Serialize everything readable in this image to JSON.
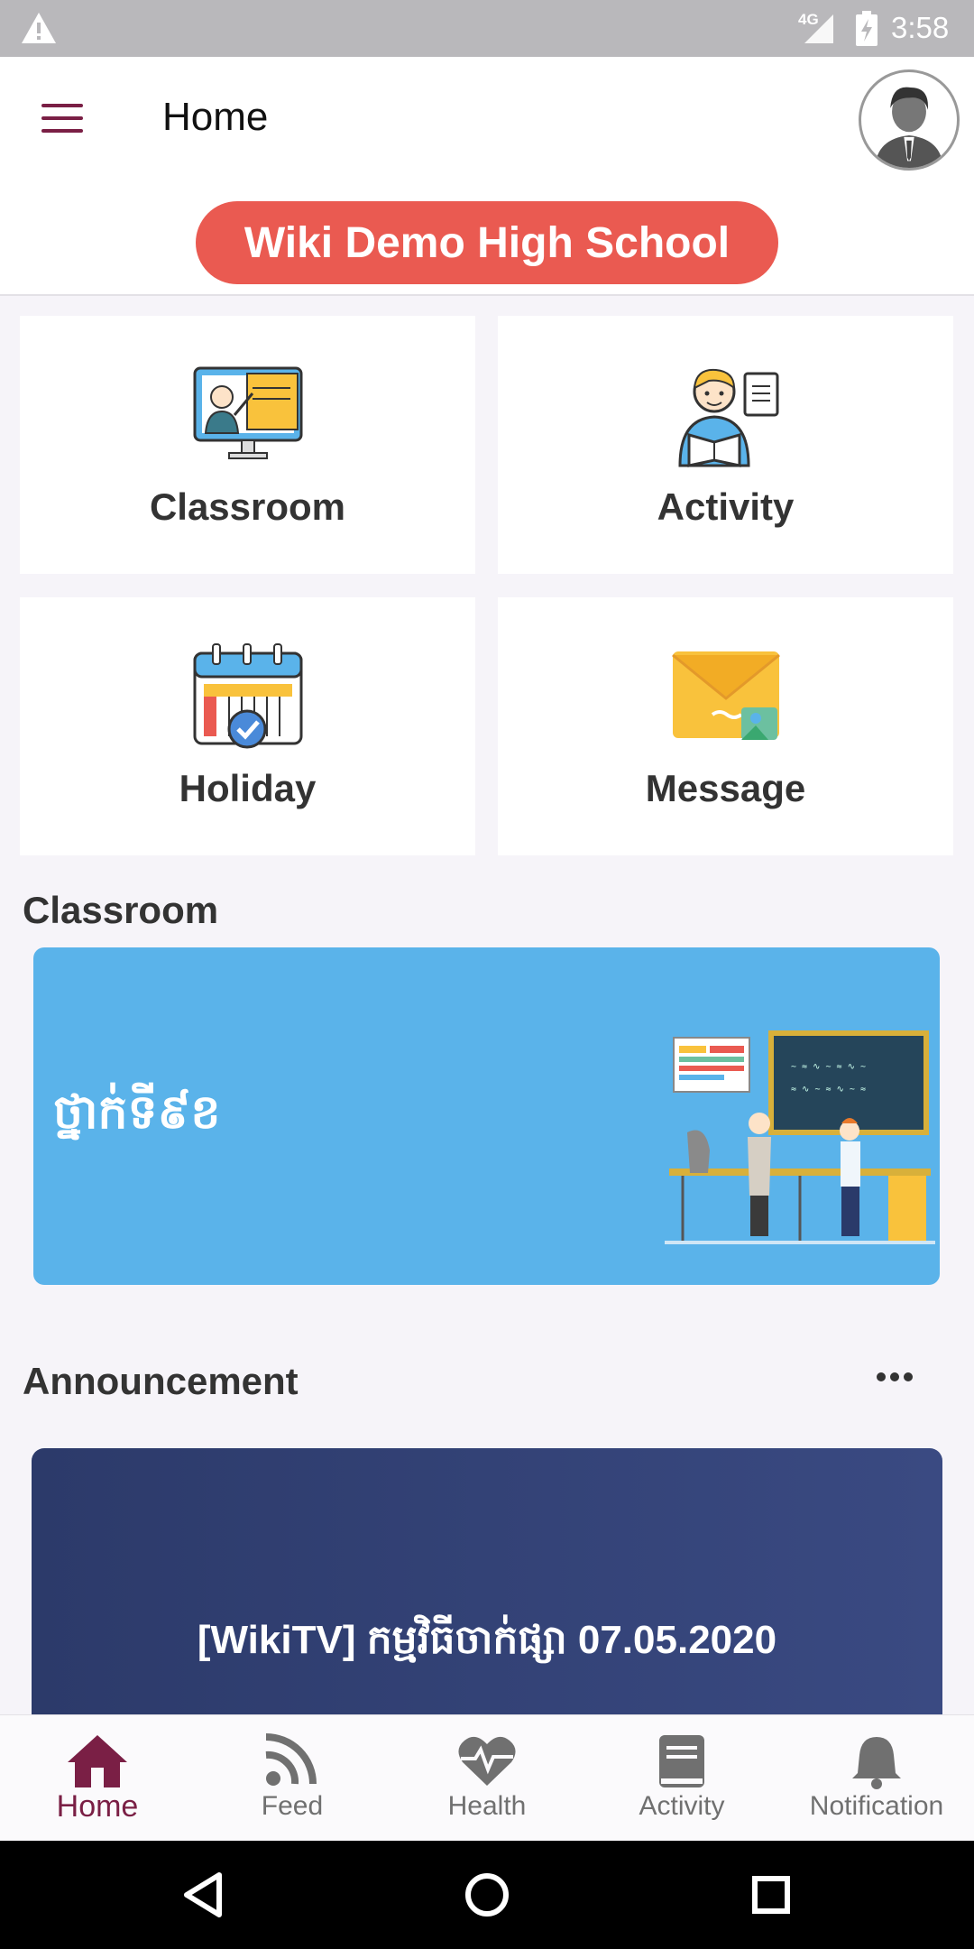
{
  "status_bar": {
    "network": "4G",
    "time": "3:58"
  },
  "app_bar": {
    "title": "Home",
    "school_name": "Wiki Demo High School"
  },
  "tiles": [
    {
      "label": "Classroom",
      "icon": "classroom-teacher-icon"
    },
    {
      "label": "Activity",
      "icon": "student-reading-icon"
    },
    {
      "label": "Holiday",
      "icon": "calendar-check-icon"
    },
    {
      "label": "Message",
      "icon": "envelope-icon"
    }
  ],
  "classroom_section": {
    "title": "Classroom",
    "card_name": "ថ្នាក់ទី៩ខ",
    "card_color": "#5ab3ea"
  },
  "announcement_section": {
    "title": "Announcement",
    "card_title": "[WikiTV] កម្មវិធីចាក់ផ្សា 07.05.2020"
  },
  "bottom_nav": {
    "items": [
      {
        "label": "Home",
        "icon": "home-icon",
        "active": true
      },
      {
        "label": "Feed",
        "icon": "rss-feed-icon",
        "active": false
      },
      {
        "label": "Health",
        "icon": "heart-pulse-icon",
        "active": false
      },
      {
        "label": "Activity",
        "icon": "book-icon",
        "active": false
      },
      {
        "label": "Notification",
        "icon": "bell-icon",
        "active": false
      }
    ]
  },
  "colors": {
    "accent": "#7a1f45",
    "pill": "#ea5a51",
    "announce_card": "#2c3a6a"
  }
}
